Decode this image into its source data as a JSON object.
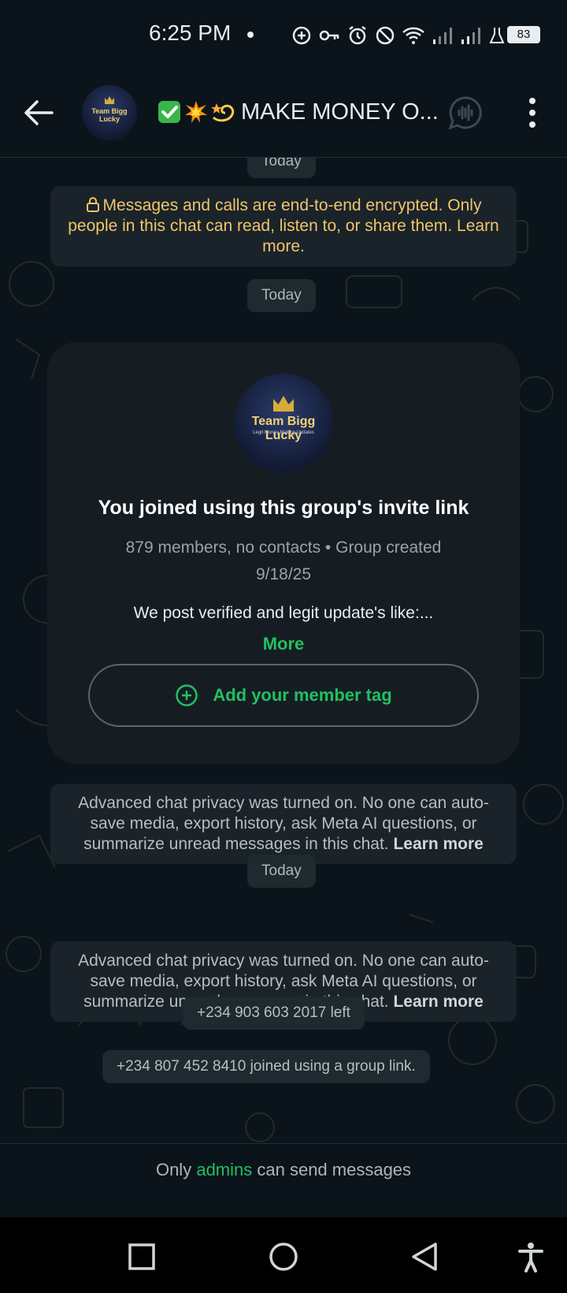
{
  "status_bar": {
    "time": "6:25 PM",
    "battery": "83",
    "icons": [
      "plus-circle-icon",
      "key-icon",
      "alarm-icon",
      "dnd-icon",
      "wifi-icon",
      "signal-icon",
      "signal-icon",
      "lab-icon"
    ]
  },
  "header": {
    "title": "MAKE MONEY O...",
    "title_emojis": [
      "check-emoji",
      "collision-emoji",
      "dizzy-emoji"
    ]
  },
  "avatar": {
    "name": "Team Bigg Lucky",
    "tagline": "Legit Money Making Updates"
  },
  "chat": {
    "date_top": "Today",
    "encryption_notice": "Messages and calls are end-to-end encrypted. Only people in this chat can read, listen to, or share them. Learn more.",
    "date_1": "Today",
    "group_card": {
      "title": "You joined using this group's invite link",
      "meta": "879 members, no contacts • Group created 9/18/25",
      "description": "We post verified and legit update's like:...",
      "more": "More",
      "tag_button": "Add your member tag"
    },
    "privacy_1": {
      "text": "Advanced chat privacy was turned on. No one can auto-save media, export history, ask Meta AI questions, or summarize unread messages in this chat.",
      "link": "Learn more"
    },
    "date_2": "Today",
    "privacy_2": {
      "text": "Advanced chat privacy was turned on. No one can auto-save media, export history, ask Meta AI questions, or summarize unread messages in this chat.",
      "link": "Learn more"
    },
    "left_event": "+234 903 603 2017 left",
    "joined_event": "+234 807 452 8410 joined using a group link."
  },
  "footer": {
    "prefix": "Only",
    "admins": "admins",
    "suffix": "can send messages"
  },
  "colors": {
    "accent_green": "#21c063",
    "background": "#0b141a",
    "encryption_text": "#f1c46b"
  }
}
